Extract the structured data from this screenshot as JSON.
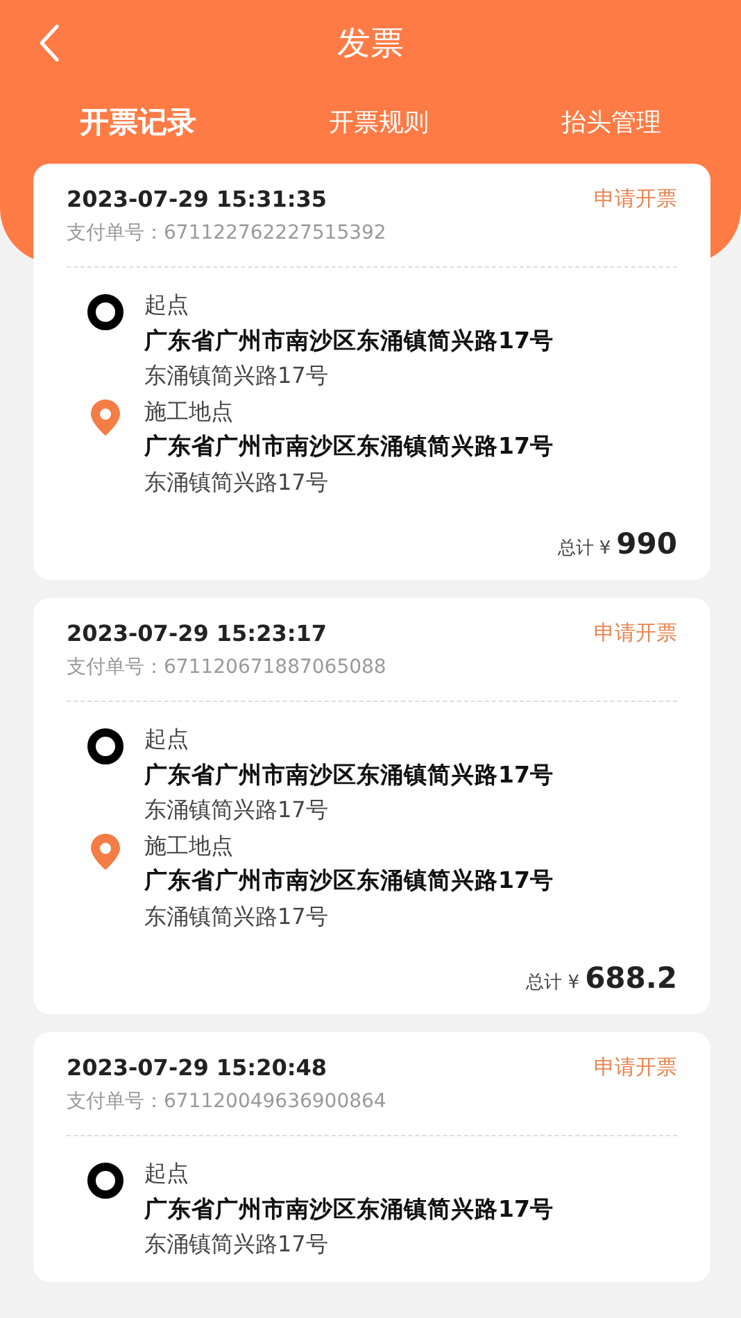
{
  "header": {
    "title": "发票"
  },
  "tabs": [
    {
      "label": "开票记录",
      "selected": true
    },
    {
      "label": "开票规则",
      "selected": false
    },
    {
      "label": "抬头管理",
      "selected": false
    }
  ],
  "records": [
    {
      "datetime": "2023-07-29 15:31:35",
      "action": "申请开票",
      "order_label": "支付单号：",
      "order_no": "671122762227515392",
      "stops": [
        {
          "kind": "start",
          "label": "起点",
          "address": "广东省广州市南沙区东涌镇简兴路17号",
          "detail": "东涌镇简兴路17号"
        },
        {
          "kind": "site",
          "label": "施工地点",
          "address": "广东省广州市南沙区东涌镇简兴路17号",
          "detail": "东涌镇简兴路17号"
        }
      ],
      "total_label": "总计",
      "currency": "¥",
      "amount": "990"
    },
    {
      "datetime": "2023-07-29 15:23:17",
      "action": "申请开票",
      "order_label": "支付单号：",
      "order_no": "671120671887065088",
      "stops": [
        {
          "kind": "start",
          "label": "起点",
          "address": "广东省广州市南沙区东涌镇简兴路17号",
          "detail": "东涌镇简兴路17号"
        },
        {
          "kind": "site",
          "label": "施工地点",
          "address": "广东省广州市南沙区东涌镇简兴路17号",
          "detail": "东涌镇简兴路17号"
        }
      ],
      "total_label": "总计",
      "currency": "¥",
      "amount": "688.2"
    },
    {
      "datetime": "2023-07-29 15:20:48",
      "action": "申请开票",
      "order_label": "支付单号：",
      "order_no": "671120049636900864",
      "stops": [
        {
          "kind": "start",
          "label": "起点",
          "address": "广东省广州市南沙区东涌镇简兴路17号",
          "detail": "东涌镇简兴路17号"
        }
      ]
    }
  ]
}
